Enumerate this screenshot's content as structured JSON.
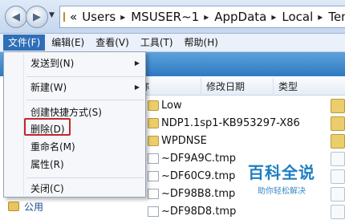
{
  "address_bar": {
    "prefix": "«",
    "segments": [
      "Users",
      "MSUSER~1",
      "AppData",
      "Local",
      "Temp"
    ]
  },
  "menubar": {
    "items": [
      "文件(F)",
      "编辑(E)",
      "查看(V)",
      "工具(T)",
      "帮助(H)"
    ]
  },
  "file_list": {
    "columns": {
      "name": "称",
      "date": "修改日期",
      "type": "类型"
    },
    "rows": [
      {
        "name": "Low",
        "kind": "folder"
      },
      {
        "name": "NDP1.1sp1-KB953297-X86",
        "kind": "folder"
      },
      {
        "name": "WPDNSE",
        "kind": "folder"
      },
      {
        "name": "~DF9A9C.tmp",
        "kind": "file"
      },
      {
        "name": "~DF60C9.tmp",
        "kind": "file"
      },
      {
        "name": "~DF98B8.tmp",
        "kind": "file"
      },
      {
        "name": "~DF98D8.tmp",
        "kind": "file"
      }
    ]
  },
  "nav_pane": {
    "public_label": "公用"
  },
  "context_menu": {
    "send_to": "发送到(N)",
    "new": "新建(W)",
    "create_shortcut": "创建快捷方式(S)",
    "delete": "删除(D)",
    "rename": "重命名(M)",
    "properties": "属性(R)",
    "close": "关闭(C)"
  },
  "watermark": {
    "title": "百科全说",
    "subtitle": "助你轻松解决"
  },
  "colors": {
    "menu_active": "#2f6fb8",
    "highlight_border": "#c0282d",
    "toolbar": "#3b86cc"
  }
}
